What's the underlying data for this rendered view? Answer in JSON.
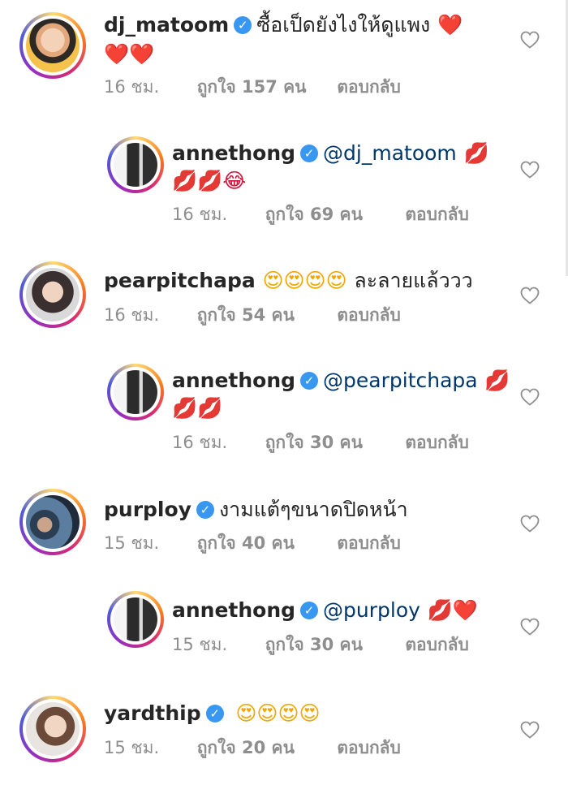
{
  "comments": [
    {
      "username": "dj_matoom",
      "text": "ซื้อเป็ดยังไงให้ดูแพง",
      "emoji1": "❤️",
      "line2": "❤️❤️",
      "time": "16 ชม.",
      "likes": "ถูกใจ 157 คน",
      "reply": "ตอบกลับ"
    },
    {
      "username": "annethong",
      "mention": "@dj_matoom",
      "emoji1": "💋",
      "line2": "💋💋😂",
      "time": "16 ชม.",
      "likes": "ถูกใจ 69 คน",
      "reply": "ตอบกลับ"
    },
    {
      "username": "pearpitchapa",
      "emoji1": "😍😍😍😍",
      "text": "ละลายแล้ววว",
      "time": "16 ชม.",
      "likes": "ถูกใจ 54 คน",
      "reply": "ตอบกลับ"
    },
    {
      "username": "annethong",
      "mention": "@pearpitchapa",
      "emoji1": "💋",
      "line2": "💋💋",
      "time": "16 ชม.",
      "likes": "ถูกใจ 30 คน",
      "reply": "ตอบกลับ"
    },
    {
      "username": "purploy",
      "text": "งามแต้ๆขนาดปิดหน้า",
      "time": "15 ชม.",
      "likes": "ถูกใจ 40 คน",
      "reply": "ตอบกลับ"
    },
    {
      "username": "annethong",
      "mention": "@purploy",
      "emoji1": "💋❤️",
      "time": "15 ชม.",
      "likes": "ถูกใจ 30 คน",
      "reply": "ตอบกลับ"
    },
    {
      "username": "yardthip",
      "emoji1": "😍😍😍😍",
      "time": "15 ชม.",
      "likes": "ถูกใจ 20 คน",
      "reply": "ตอบกลับ"
    }
  ],
  "icons": {
    "verified": "verified-badge-icon",
    "like": "heart-outline-icon"
  },
  "colors": {
    "verified": "#3897f0",
    "meta": "#8e8e8e",
    "mention": "#00376b",
    "username": "#262626"
  }
}
